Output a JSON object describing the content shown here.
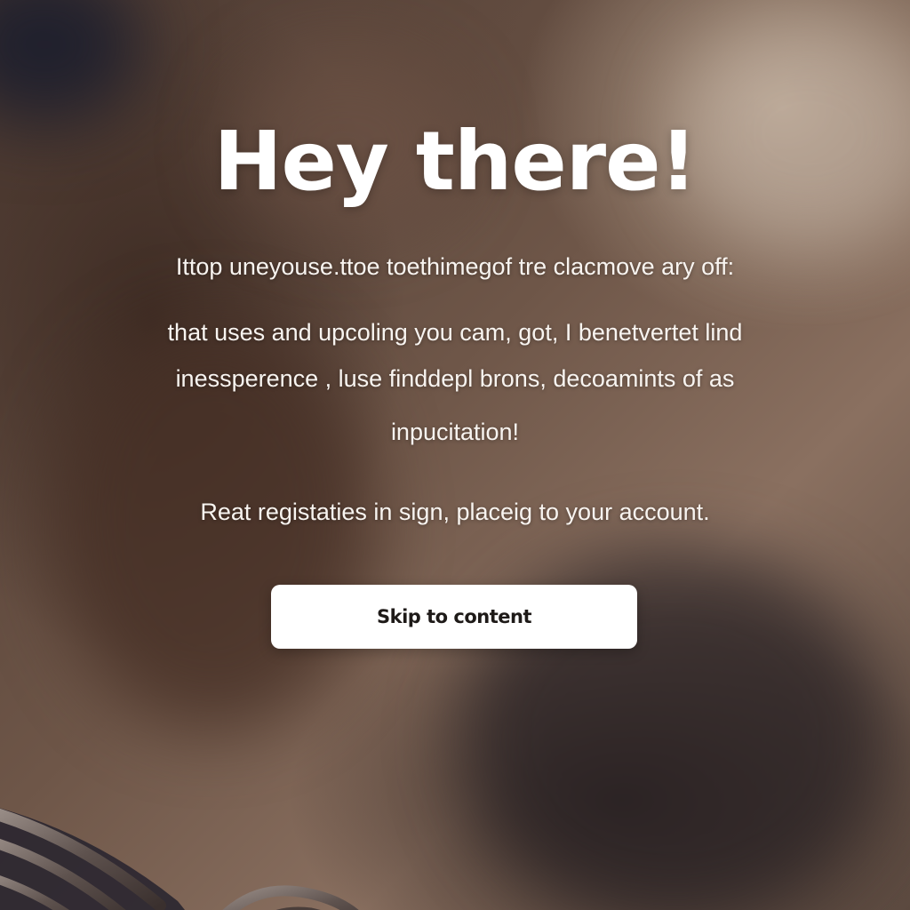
{
  "hero": {
    "title": "Hey there!",
    "lines": [
      "Ittop uneyouse.ttoe toethimegof tre clacmove ary off:",
      "that uses and upcoling you cam, got, I benetvertet lind",
      "inessperence , luse finddерl brons, decoamints of as",
      "inpucitation!",
      "Reat registaties in sign, placeig to your account."
    ]
  },
  "actions": {
    "skip_label": "Skip to content"
  }
}
